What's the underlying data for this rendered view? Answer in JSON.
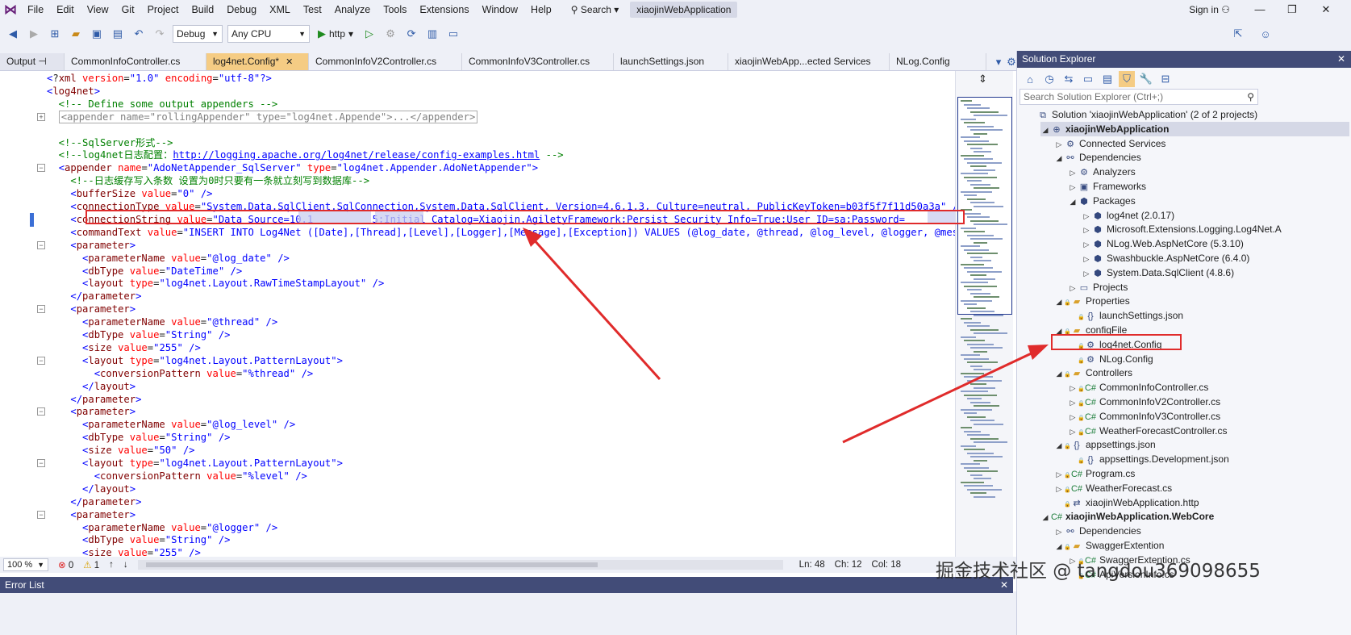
{
  "menubar": {
    "items": [
      "File",
      "Edit",
      "View",
      "Git",
      "Project",
      "Build",
      "Debug",
      "XML",
      "Test",
      "Analyze",
      "Tools",
      "Extensions",
      "Window",
      "Help"
    ],
    "search_label": "Search",
    "app_title": "xiaojinWebApplication",
    "signin_label": "Sign in"
  },
  "toolbar": {
    "config_value": "Debug",
    "platform_value": "Any CPU",
    "run_label": "http"
  },
  "tabs": {
    "output_label": "Output",
    "items": [
      "CommonInfoController.cs",
      "log4net.Config*",
      "CommonInfoV2Controller.cs",
      "CommonInfoV3Controller.cs",
      "launchSettings.json",
      "xiaojinWebApp...ected Services",
      "NLog.Config"
    ]
  },
  "editor": {
    "lines": [
      "<?xml version=\"1.0\" encoding=\"utf-8\"?>",
      "<log4net>",
      "  <!-- Define some output appenders -->",
      "  <appender name=\"rollingAppender\" type=\"log4net.Appende\">...</appender>",
      "",
      "  <!--SqlServer形式-->",
      "  <!--log4net日志配置：http://logging.apache.org/log4net/release/config-examples.html -->",
      "  <appender name=\"AdoNetAppender_SqlServer\" type=\"log4net.Appender.AdoNetAppender\">",
      "    <!--日志缓存写入条数 设置为0时只要有一条就立刻写到数据库-->",
      "    <bufferSize value=\"0\" />",
      "    <connectionType value=\"System.Data.SqlClient.SqlConnection,System.Data.SqlClient, Version=4.6.1.3, Culture=neutral, PublicKeyToken=b03f5f7f11d50a3a\" />",
      "    <connectionString value=\"Data Source=10.1          5;Initial Catalog=Xiaojin.AgiletyFramework;Persist Security Info=True;User ID=sa;Password=",
      "    <commandText value=\"INSERT INTO Log4Net ([Date],[Thread],[Level],[Logger],[Message],[Exception]) VALUES (@log_date, @thread, @log_level, @logger, @mess",
      "    <parameter>",
      "      <parameterName value=\"@log_date\" />",
      "      <dbType value=\"DateTime\" />",
      "      <layout type=\"log4net.Layout.RawTimeStampLayout\" />",
      "    </parameter>",
      "    <parameter>",
      "      <parameterName value=\"@thread\" />",
      "      <dbType value=\"String\" />",
      "      <size value=\"255\" />",
      "      <layout type=\"log4net.Layout.PatternLayout\">",
      "        <conversionPattern value=\"%thread\" />",
      "      </layout>",
      "    </parameter>",
      "    <parameter>",
      "      <parameterName value=\"@log_level\" />",
      "      <dbType value=\"String\" />",
      "      <size value=\"50\" />",
      "      <layout type=\"log4net.Layout.PatternLayout\">",
      "        <conversionPattern value=\"%level\" />",
      "      </layout>",
      "    </parameter>",
      "    <parameter>",
      "      <parameterName value=\"@logger\" />",
      "      <dbType value=\"String\" />",
      "      <size value=\"255\" />"
    ]
  },
  "status": {
    "zoom": "100 %",
    "errors": "0",
    "warnings": "1",
    "line": "Ln: 48",
    "char": "Ch: 12",
    "col": "Col: 18"
  },
  "errorlist_title": "Error List",
  "solution_explorer": {
    "title": "Solution Explorer",
    "search_placeholder": "Search Solution Explorer (Ctrl+;)",
    "items": [
      {
        "label": "Solution 'xiaojinWebApplication' (2 of 2 projects)"
      },
      {
        "label": "xiaojinWebApplication"
      },
      {
        "label": "Connected Services"
      },
      {
        "label": "Dependencies"
      },
      {
        "label": "Analyzers"
      },
      {
        "label": "Frameworks"
      },
      {
        "label": "Packages"
      },
      {
        "label": "log4net (2.0.17)"
      },
      {
        "label": "Microsoft.Extensions.Logging.Log4Net.A"
      },
      {
        "label": "NLog.Web.AspNetCore (5.3.10)"
      },
      {
        "label": "Swashbuckle.AspNetCore (6.4.0)"
      },
      {
        "label": "System.Data.SqlClient (4.8.6)"
      },
      {
        "label": "Projects"
      },
      {
        "label": "Properties"
      },
      {
        "label": "launchSettings.json"
      },
      {
        "label": "configFile"
      },
      {
        "label": "log4net.Config"
      },
      {
        "label": "NLog.Config"
      },
      {
        "label": "Controllers"
      },
      {
        "label": "CommonInfoController.cs"
      },
      {
        "label": "CommonInfoV2Controller.cs"
      },
      {
        "label": "CommonInfoV3Controller.cs"
      },
      {
        "label": "WeatherForecastController.cs"
      },
      {
        "label": "appsettings.json"
      },
      {
        "label": "appsettings.Development.json"
      },
      {
        "label": "Program.cs"
      },
      {
        "label": "WeatherForecast.cs"
      },
      {
        "label": "xiaojinWebApplication.http"
      },
      {
        "label": "xiaojinWebApplication.WebCore"
      },
      {
        "label": "Dependencies"
      },
      {
        "label": "SwaggerExtention"
      },
      {
        "label": "SwaggerExtention.cs"
      },
      {
        "label": "ApiVersionInfo.cs"
      }
    ]
  },
  "watermark": "掘金技术社区 @ tangdou369098655",
  "colors": {
    "accent": "#424c78",
    "active_tab": "#f5cc84",
    "annotation_red": "#e02b2b"
  }
}
